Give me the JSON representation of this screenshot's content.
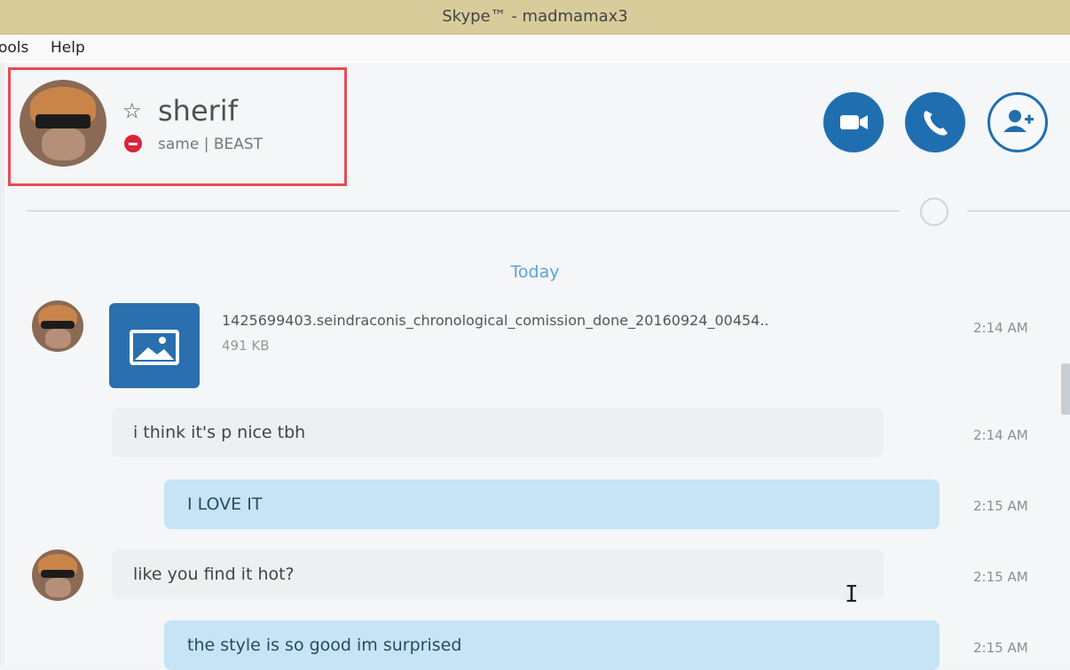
{
  "window": {
    "title": "Skype™ - madmamax3"
  },
  "menubar": {
    "items": [
      "ools",
      "Help"
    ]
  },
  "contact": {
    "name": "sherif",
    "mood": "same | BEAST",
    "status": "do-not-disturb"
  },
  "header_actions": {
    "video_icon": "video-camera-icon",
    "call_icon": "phone-icon",
    "add_people_icon": "add-person-icon"
  },
  "conversation": {
    "day_label": "Today",
    "messages": [
      {
        "direction": "in",
        "type": "file",
        "file_name": "1425699403.seindraconis_chronological_comission_done_20160924_00454..",
        "file_size": "491 KB",
        "time": "2:14 AM"
      },
      {
        "direction": "in",
        "type": "text",
        "text": "i think it's p nice tbh",
        "time": "2:14 AM"
      },
      {
        "direction": "out",
        "type": "text",
        "text": "I LOVE IT",
        "time": "2:15 AM"
      },
      {
        "direction": "in",
        "type": "text",
        "text": "like you find it hot?",
        "time": "2:15 AM"
      },
      {
        "direction": "out",
        "type": "text",
        "text": "the style is so good im surprised",
        "time": "2:15 AM"
      }
    ]
  },
  "colors": {
    "accent": "#1f6fb0",
    "outgoing_bubble": "#c6e4f5",
    "incoming_bubble": "#eeeff1",
    "highlight": "#e84a55",
    "dnd": "#d7263a"
  }
}
